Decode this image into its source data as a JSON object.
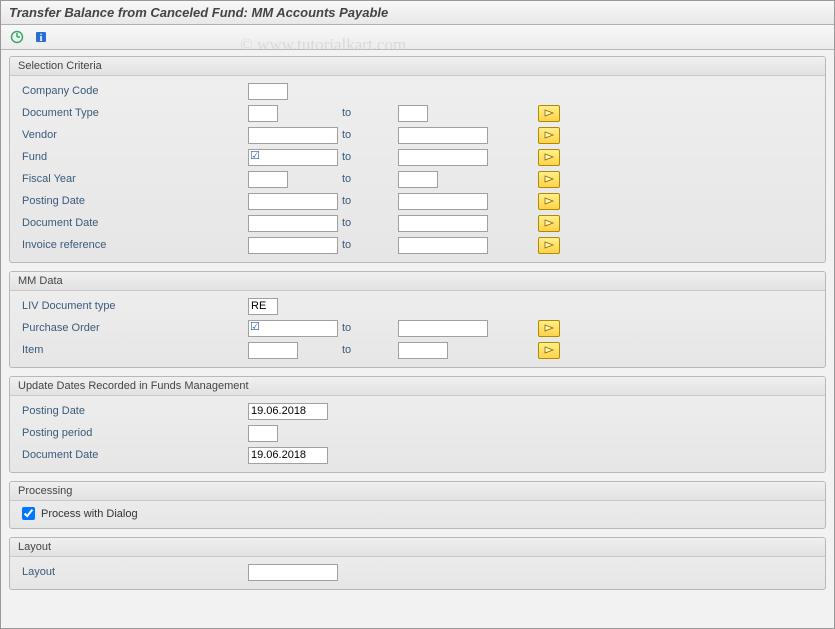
{
  "header": {
    "title": "Transfer Balance from Canceled Fund: MM  Accounts Payable"
  },
  "watermark": "© www.tutorialkart.com",
  "groups": {
    "selection": {
      "title": "Selection Criteria",
      "company_code": "Company Code",
      "document_type": "Document Type",
      "vendor": "Vendor",
      "fund": "Fund",
      "fiscal_year": "Fiscal Year",
      "posting_date": "Posting Date",
      "document_date": "Document Date",
      "invoice_ref": "Invoice reference"
    },
    "mm": {
      "title": "MM Data",
      "liv_doc_type": "LIV Document type",
      "liv_value": "RE",
      "purchase_order": "Purchase Order",
      "item": "Item"
    },
    "update": {
      "title": "Update Dates Recorded in Funds Management",
      "posting_date": "Posting Date",
      "posting_date_val": "19.06.2018",
      "posting_period": "Posting period",
      "document_date": "Document Date",
      "document_date_val": "19.06.2018"
    },
    "processing": {
      "title": "Processing",
      "dialog": "Process with Dialog"
    },
    "layout": {
      "title": "Layout",
      "layout": "Layout"
    }
  },
  "to_label": "to"
}
